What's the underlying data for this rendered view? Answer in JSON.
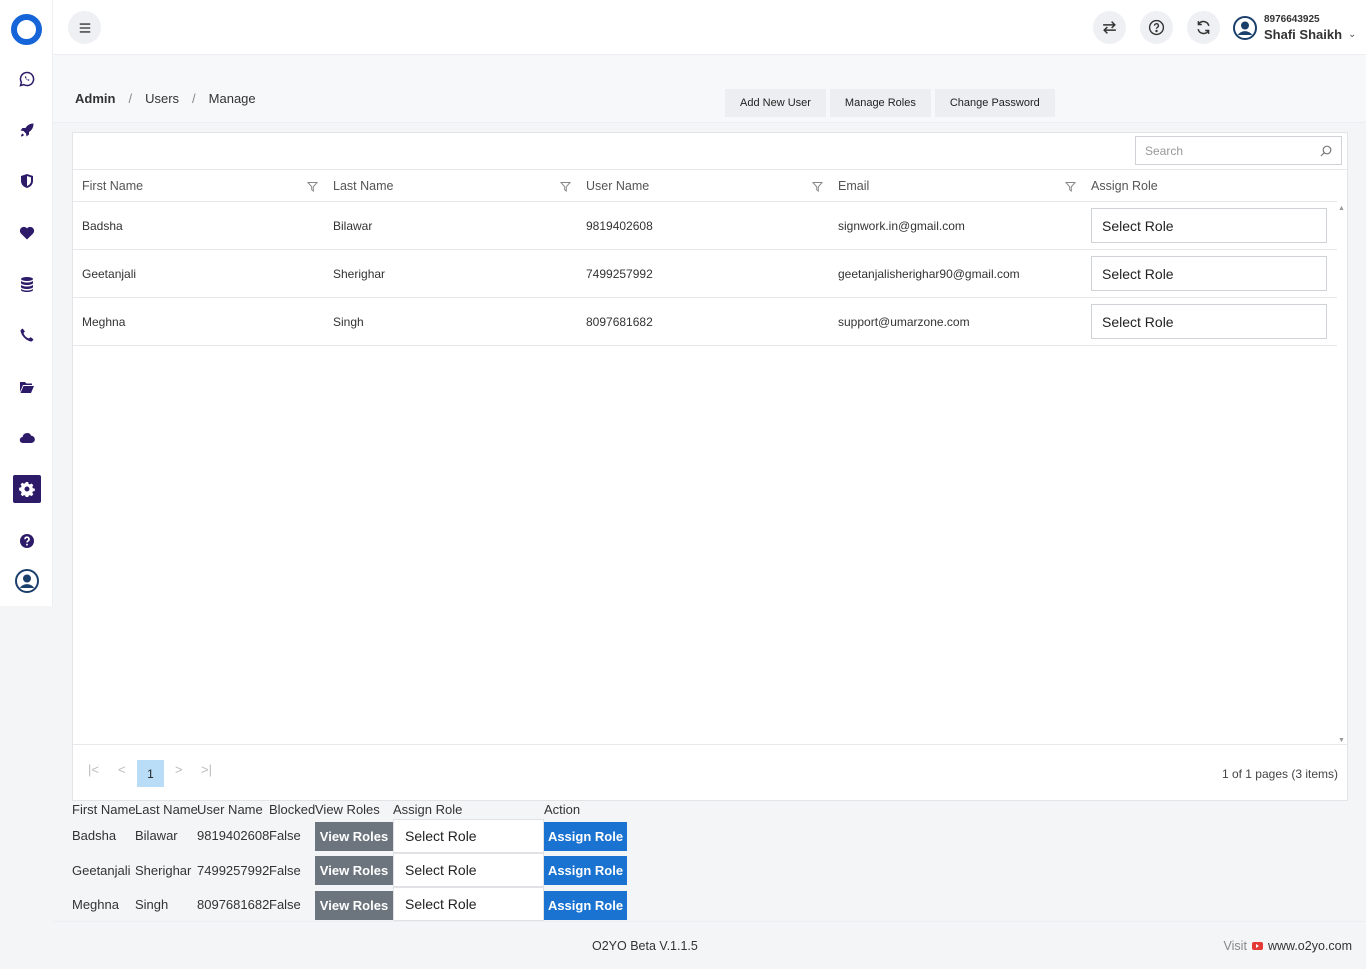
{
  "topbar": {
    "user_phone": "8976643925",
    "user_name": "Shafi Shaikh"
  },
  "sidebar": {
    "items": [
      "whatsapp-icon",
      "rocket-icon",
      "shield-icon",
      "heart-icon",
      "database-icon",
      "phone-icon",
      "folder-open-icon",
      "cloud-icon",
      "gear-icon",
      "help-icon",
      "profile-icon"
    ],
    "active": "gear-icon",
    "accent_color": "#2d1b69"
  },
  "breadcrumb": {
    "admin": "Admin",
    "sep1": "/",
    "users": "Users",
    "sep2": "/",
    "manage": "Manage"
  },
  "actions": {
    "add_new_user": "Add New User",
    "manage_roles": "Manage Roles",
    "change_password": "Change Password"
  },
  "grid": {
    "search_placeholder": "Search",
    "columns": [
      "First Name",
      "Last Name",
      "User Name",
      "Email",
      "Assign Role"
    ],
    "rows": [
      {
        "first": "Badsha",
        "last": "Bilawar",
        "user": "9819402608",
        "email": "signwork.in@gmail.com",
        "role": "Select Role"
      },
      {
        "first": "Geetanjali",
        "last": "Sherighar",
        "user": "7499257992",
        "email": "geetanjalisherighar90@gmail.com",
        "role": "Select Role"
      },
      {
        "first": "Meghna",
        "last": "Singh",
        "user": "8097681682",
        "email": "support@umarzone.com",
        "role": "Select Role"
      }
    ],
    "pager": {
      "current_page": "1",
      "info": "1 of 1 pages (3 items)"
    }
  },
  "raw_table": {
    "headers": {
      "first": "First Name",
      "last": "Last Name",
      "user": "User Name",
      "blocked": "Blocked",
      "view": "View Roles",
      "assign": "Assign Role",
      "action": "Action"
    },
    "rows": [
      {
        "first": "Badsha",
        "last": "Bilawar",
        "user": "9819402608",
        "blocked": "False",
        "view_btn": "View Roles",
        "role": "Select Role",
        "assign_btn": "Assign Role"
      },
      {
        "first": "Geetanjali",
        "last": "Sherighar",
        "user": "7499257992",
        "blocked": "False",
        "view_btn": "View Roles",
        "role": "Select Role",
        "assign_btn": "Assign Role"
      },
      {
        "first": "Meghna",
        "last": "Singh",
        "user": "8097681682",
        "blocked": "False",
        "view_btn": "View Roles",
        "role": "Select Role",
        "assign_btn": "Assign Role"
      }
    ]
  },
  "footer": {
    "version": "O2YO Beta V.1.1.5",
    "visit": "Visit",
    "url": "www.o2yo.com"
  },
  "colors": {
    "brand_blue": "#1565d8",
    "pager_active": "#b9dcf7",
    "assign_button": "#1a73d0",
    "view_button": "#6c757d"
  }
}
